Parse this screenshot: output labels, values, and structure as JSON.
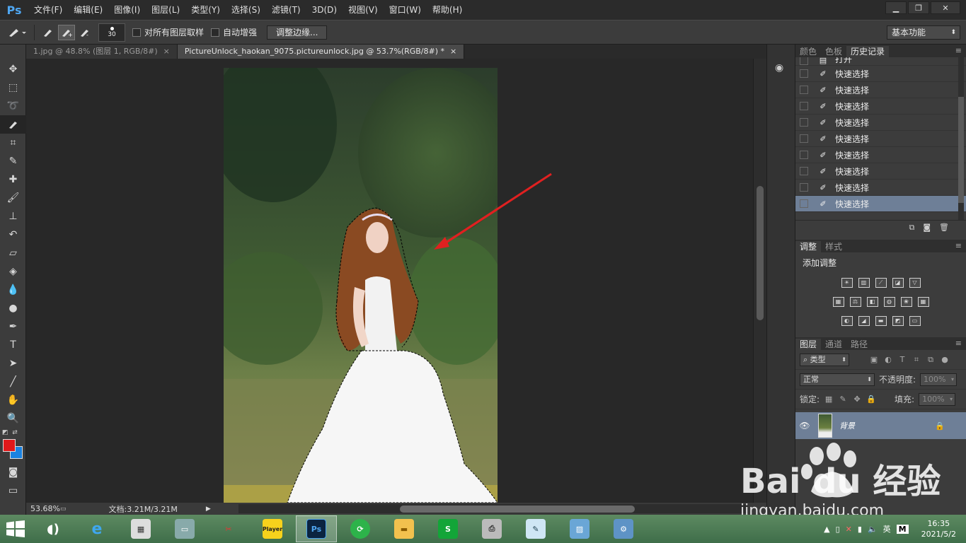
{
  "app": {
    "logo": "Ps"
  },
  "menu": [
    "文件(F)",
    "编辑(E)",
    "图像(I)",
    "图层(L)",
    "类型(Y)",
    "选择(S)",
    "滤镜(T)",
    "3D(D)",
    "视图(V)",
    "窗口(W)",
    "帮助(H)"
  ],
  "options": {
    "brush_size": "30",
    "sample_all_layers": "对所有图层取样",
    "auto_enhance": "自动增强",
    "refine_edge": "调整边缘...",
    "workspace": "基本功能"
  },
  "tabs": [
    {
      "label": "1.jpg @ 48.8% (图层 1, RGB/8#)",
      "close": "×"
    },
    {
      "label": "PictureUnlock_haokan_9075.pictureunlock.jpg @ 53.7%(RGB/8#) *",
      "close": "×"
    }
  ],
  "status": {
    "zoom": "53.68%",
    "doc": "文档:3.21M/3.21M"
  },
  "panel_top": {
    "tabs": [
      "颜色",
      "色板",
      "历史记录"
    ],
    "history": [
      {
        "label": "打开",
        "icon": "document-icon"
      },
      {
        "label": "快速选择"
      },
      {
        "label": "快速选择"
      },
      {
        "label": "快速选择"
      },
      {
        "label": "快速选择"
      },
      {
        "label": "快速选择"
      },
      {
        "label": "快速选择"
      },
      {
        "label": "快速选择"
      },
      {
        "label": "快速选择"
      },
      {
        "label": "快速选择"
      }
    ]
  },
  "panel_adjust": {
    "tabs": [
      "调整",
      "样式"
    ],
    "title": "添加调整"
  },
  "panel_layers": {
    "tabs": [
      "图层",
      "通道",
      "路径"
    ],
    "filter_kind": "类型",
    "blend_mode": "正常",
    "opacity_label": "不透明度:",
    "opacity": "100%",
    "lock_label": "锁定:",
    "fill_label": "填充:",
    "fill": "100%",
    "layer_name": "背景"
  },
  "taskbar": {
    "player_label": "Player",
    "ps_label": "Ps",
    "time": "16:35",
    "date": "2021/5/2",
    "ime": "英",
    "ime2": "M"
  },
  "watermark": {
    "brand": "Bai  du 经验",
    "url": "jingyan.baidu.com"
  },
  "colors": {
    "foreground": "#e0191b",
    "background": "#1a82e0",
    "selection_highlight": "#6e7f97"
  }
}
